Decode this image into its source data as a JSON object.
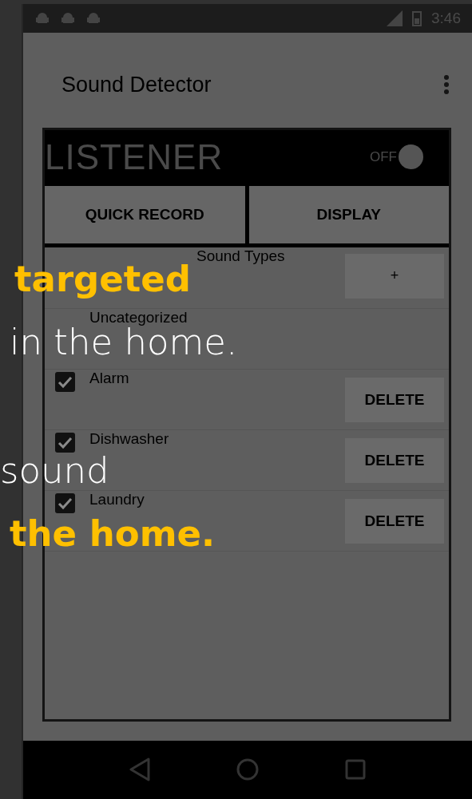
{
  "status_bar": {
    "time": "3:46"
  },
  "app_bar": {
    "title": "Sound Detector"
  },
  "listener": {
    "title": "LISTENER",
    "switch_label": "OFF",
    "on": false
  },
  "buttons": [
    "QUICK RECORD",
    "DISPLAY"
  ],
  "sound_types": {
    "header": "Sound Types",
    "add_label": "+",
    "items": [
      {
        "kind": "plain",
        "name": "Uncategorized"
      },
      {
        "kind": "deletable",
        "name": "Alarm",
        "checked": true,
        "delete_label": "DELETE"
      },
      {
        "kind": "deletable",
        "name": "Dishwasher",
        "checked": true,
        "delete_label": "DELETE"
      },
      {
        "kind": "deletable",
        "name": "Laundry",
        "checked": true,
        "delete_label": "DELETE"
      }
    ]
  },
  "overlay_text": [
    {
      "text": "targeted",
      "emphasis": true
    },
    {
      "text": "in the home.",
      "emphasis": false
    },
    {
      "text": "sound",
      "emphasis": false
    },
    {
      "text": "the home.",
      "emphasis": true
    }
  ]
}
